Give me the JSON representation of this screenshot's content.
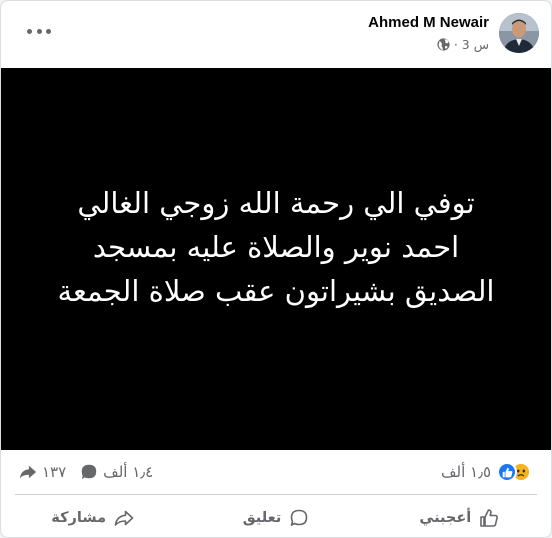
{
  "post": {
    "author": "Ahmed M Newair",
    "time": "3 س",
    "separator": "·",
    "privacy_icon": "globe-icon",
    "more_icon": "more-options-icon"
  },
  "media": {
    "lines": [
      "توفي الي رحمة الله زوجي الغالي",
      "احمد نوير والصلاة عليه بمسجد",
      "الصديق بشيراتون عقب صلاة الجمعة"
    ],
    "background": "#000000",
    "text_color": "#ffffff"
  },
  "stats": {
    "reactions_count": "١٫٥ ألف",
    "reaction_icons": [
      "like-reaction-icon",
      "sad-reaction-icon"
    ],
    "comments_count": "١٫٤ ألف",
    "shares_count": "١٣٧"
  },
  "actions": {
    "like": "أعجبني",
    "comment": "تعليق",
    "share": "مشاركة"
  },
  "colors": {
    "like_blue": "#1877f2",
    "sad_yellow": "#f7b125",
    "secondary_text": "#65676b"
  }
}
